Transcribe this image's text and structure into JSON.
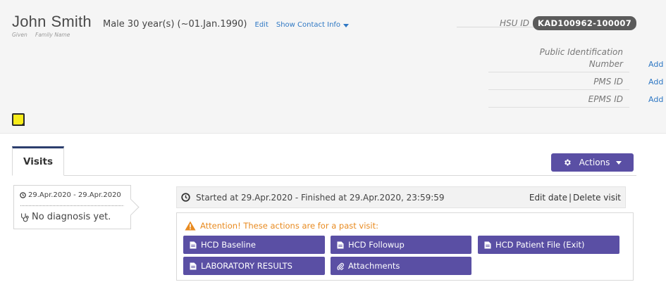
{
  "patient": {
    "given_name": "John",
    "family_name": "Smith",
    "given_label": "Given",
    "family_label": "Family Name",
    "gender": "Male",
    "age": "30 year(s) (~01.Jan.1990)",
    "edit_label": "Edit",
    "contact_label": "Show Contact Info"
  },
  "hsu": {
    "label": "HSU ID",
    "value": "KAD100962-100007"
  },
  "identifiers": [
    {
      "label": "Public Identification Number",
      "action": "Add"
    },
    {
      "label": "PMS ID",
      "action": "Add"
    },
    {
      "label": "EPMS ID",
      "action": "Add"
    }
  ],
  "tabs": {
    "visits_label": "Visits",
    "actions_label": "Actions"
  },
  "visit_list": {
    "date_range": "29.Apr.2020 - 29.Apr.2020",
    "diagnosis": "No diagnosis yet."
  },
  "visit_detail": {
    "status": "Started at 29.Apr.2020 - Finished at 29.Apr.2020, 23:59:59",
    "edit_date": "Edit date",
    "separator": "|",
    "delete_visit": "Delete visit",
    "attention": "Attention! These actions are for a past visit:",
    "buttons": [
      "HCD Baseline",
      "HCD Followup",
      "HCD Patient File (Exit)",
      "LABORATORY RESULTS",
      "Attachments"
    ]
  },
  "colors": {
    "accent": "#5a4fa4",
    "link": "#2f78c4",
    "warning": "#e88a1f",
    "badge": "#5b5b5b",
    "sticky_note": "#f7ec1a"
  },
  "icons": [
    "caret-down-icon",
    "gear-icon",
    "clock-icon",
    "stethoscope-icon",
    "warning-icon",
    "document-icon",
    "paperclip-icon",
    "sticky-note-icon"
  ]
}
